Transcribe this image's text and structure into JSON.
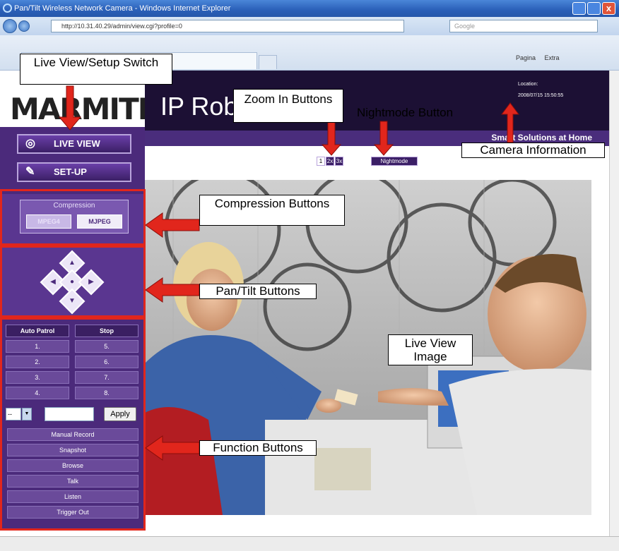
{
  "browser": {
    "window_title": "Pan/Tilt Wireless Network Camera - Windows Internet Explorer",
    "address": "http://10.31.40.29/admin/view.cgi?profile=0",
    "search_placeholder": "Google",
    "close_glyph": "x",
    "toolbar_items": [
      "Pagina",
      "Extra"
    ]
  },
  "page": {
    "logo": "MARMITEK.",
    "header_title": "IP Rob",
    "location_label": "Location:",
    "location_datetime": "2008/07/15 15:50:55",
    "slogan": "Smart Solutions at Home",
    "live_view_button": "LIVE VIEW",
    "setup_button": "SET-UP",
    "zoom": {
      "in1": "1",
      "in2": "2x",
      "in3": "3x",
      "nightmode": "Nightmode"
    },
    "compression": {
      "title": "Compression",
      "mpeg4": "MPEG4",
      "mjpeg": "MJPEG"
    },
    "patrol": {
      "headers": [
        "Auto Patrol",
        "Stop"
      ],
      "left": [
        "1.",
        "2.",
        "3.",
        "4."
      ],
      "right": [
        "5.",
        "6.",
        "7.",
        "8."
      ]
    },
    "preset_select": "--",
    "apply_button": "Apply",
    "functions": [
      "Manual Record",
      "Snapshot",
      "Browse",
      "Talk",
      "Listen",
      "Trigger Out"
    ]
  },
  "annotations": {
    "live_view_setup_switch": "Live View/Setup Switch",
    "zoom_in_buttons": "Zoom In Buttons",
    "nightmode_button": "Nightmode Button",
    "camera_information": "Camera Information",
    "compression_buttons": "Compression Buttons",
    "pan_tilt_buttons": "Pan/Tilt Buttons",
    "live_view_image": "Live View Image",
    "function_buttons": "Function Buttons"
  },
  "colors": {
    "purple_dark": "#4b2a7b",
    "header_dark": "#1c1034",
    "callout_red": "#e1261c"
  }
}
